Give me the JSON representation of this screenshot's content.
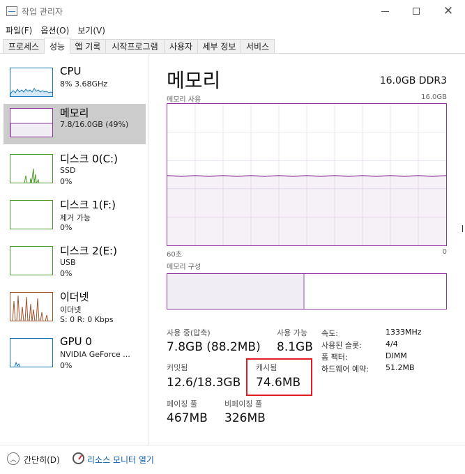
{
  "window": {
    "title": "작업 관리자"
  },
  "menu": [
    "파일(F)",
    "옵션(O)",
    "보기(V)"
  ],
  "tabs": [
    "프로세스",
    "성능",
    "앱 기록",
    "시작프로그램",
    "사용자",
    "세부 정보",
    "서비스"
  ],
  "active_tab": "성능",
  "sidebar": [
    {
      "name": "CPU",
      "line1": "8% 3.68GHz",
      "line2": "",
      "selected": false,
      "color": "#1779ba"
    },
    {
      "name": "메모리",
      "line1": "7.8/16.0GB (49%)",
      "line2": "",
      "selected": true,
      "color": "#8b3a9b"
    },
    {
      "name": "디스크 0(C:)",
      "line1": "SSD",
      "line2": "0%",
      "selected": false,
      "color": "#4c9a2a"
    },
    {
      "name": "디스크 1(F:)",
      "line1": "제거 가능",
      "line2": "0%",
      "selected": false,
      "color": "#4c9a2a"
    },
    {
      "name": "디스크 2(E:)",
      "line1": "USB",
      "line2": "0%",
      "selected": false,
      "color": "#4c9a2a"
    },
    {
      "name": "이더넷",
      "line1": "이더넷",
      "line2": "S: 0 R: 0 Kbps",
      "selected": false,
      "color": "#a0522d"
    },
    {
      "name": "GPU 0",
      "line1": "NVIDIA GeForce ...",
      "line2": "0%",
      "selected": false,
      "color": "#1779ba"
    }
  ],
  "main": {
    "title": "메모리",
    "spec": "16.0GB DDR3",
    "usage_label": "메모리 사용",
    "usage_max": "16.0GB",
    "time_left": "60초",
    "time_right": "0",
    "composition_label": "메모리 구성",
    "usage_fraction": 0.49
  },
  "stats": {
    "in_use_label": "사용 중(압축)",
    "in_use_value": "7.8GB (88.2MB)",
    "available_label": "사용 가능",
    "available_value": "8.1GB",
    "committed_label": "커밋됨",
    "committed_value": "12.6/18.3GB",
    "cached_label": "캐시됨",
    "cached_value": "74.6MB",
    "paged_label": "페이징 풀",
    "paged_value": "467MB",
    "nonpaged_label": "비페이징 풀",
    "nonpaged_value": "326MB"
  },
  "info": [
    {
      "key": "속도:",
      "value": "1333MHz"
    },
    {
      "key": "사용된 슬롯:",
      "value": "4/4"
    },
    {
      "key": "폼 팩터:",
      "value": "DIMM"
    },
    {
      "key": "하드웨어 예약:",
      "value": "51.2MB"
    }
  ],
  "footer": {
    "collapse": "간단히(D)",
    "resource_monitor": "리소스 모니터 열기"
  },
  "colors": {
    "memory": "#8b3a9b",
    "cpu": "#1779ba",
    "disk": "#4c9a2a",
    "ethernet": "#a0522d",
    "highlight": "#e01b24"
  }
}
